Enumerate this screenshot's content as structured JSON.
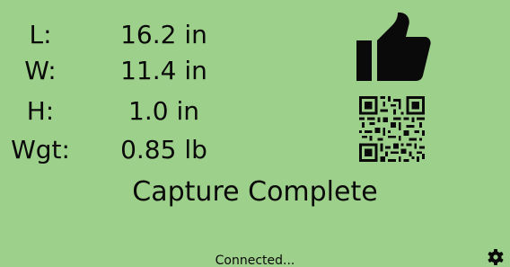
{
  "measurements": [
    {
      "label": "L:",
      "value": "16.2 in"
    },
    {
      "label": "W:",
      "value": "11.4 in"
    },
    {
      "label": "H:",
      "value": "1.0 in"
    },
    {
      "label": "Wgt:",
      "value": "0.85 lb"
    }
  ],
  "status": {
    "message": "Capture Complete",
    "connection": "Connected..."
  },
  "icons": {
    "result": "thumbs-up-icon",
    "code": "qr-code-icon",
    "settings": "gear-icon"
  },
  "colors": {
    "background": "#9dd08a",
    "foreground": "#0a0a0a"
  }
}
